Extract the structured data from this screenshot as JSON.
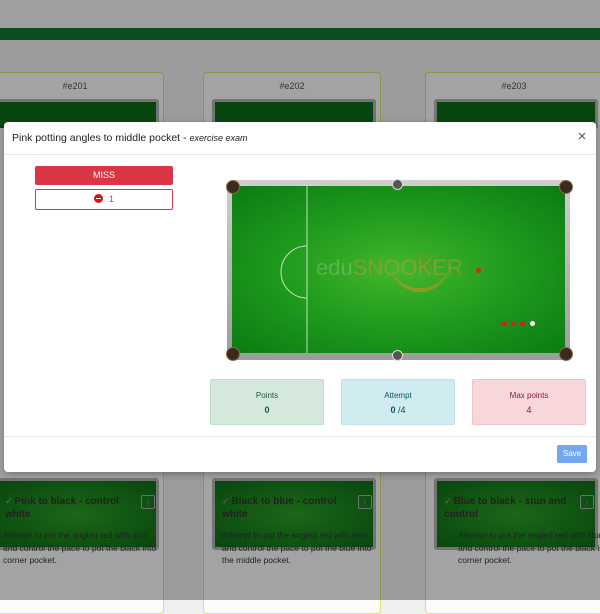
{
  "background": {
    "cards": [
      {
        "code": "#e201",
        "title": "Pink to black - control white",
        "desc": "Attempt to pot the angled red with stun and control the pace to pot the black into corner pocket."
      },
      {
        "code": "#e202",
        "title": "Black to blue - control white",
        "desc": "Attempt to pot the angled red with stun and control the pace to pot the blue into the middle pocket."
      },
      {
        "code": "#e203",
        "title": "Blue to black - stun and control",
        "desc": "Attempt to pot the angled red with stun and control the pace to pot the black into corner pocket."
      }
    ]
  },
  "modal": {
    "title": "Pink potting angles to middle pocket",
    "title_separator": " - ",
    "subtitle": "exercise exam",
    "close_glyph": "×",
    "miss_label": "MISS",
    "miss_count": "1",
    "watermark": {
      "prefix": "edu",
      "brand": "SNOOKER"
    },
    "stats": {
      "points": {
        "label": "Points",
        "value": "0"
      },
      "attempt": {
        "label": "Attempt",
        "value": "0",
        "of": "/4"
      },
      "max_points": {
        "label": "Max points",
        "value": "4"
      }
    },
    "save_label": "Save"
  },
  "icons": {
    "close": "close-icon",
    "ball": "red-ball-icon",
    "info": "info-icon",
    "check": "check-icon"
  },
  "colors": {
    "brand_green": "#0f7a35",
    "miss_red": "#dc3545",
    "save_blue": "#74a6f2"
  }
}
